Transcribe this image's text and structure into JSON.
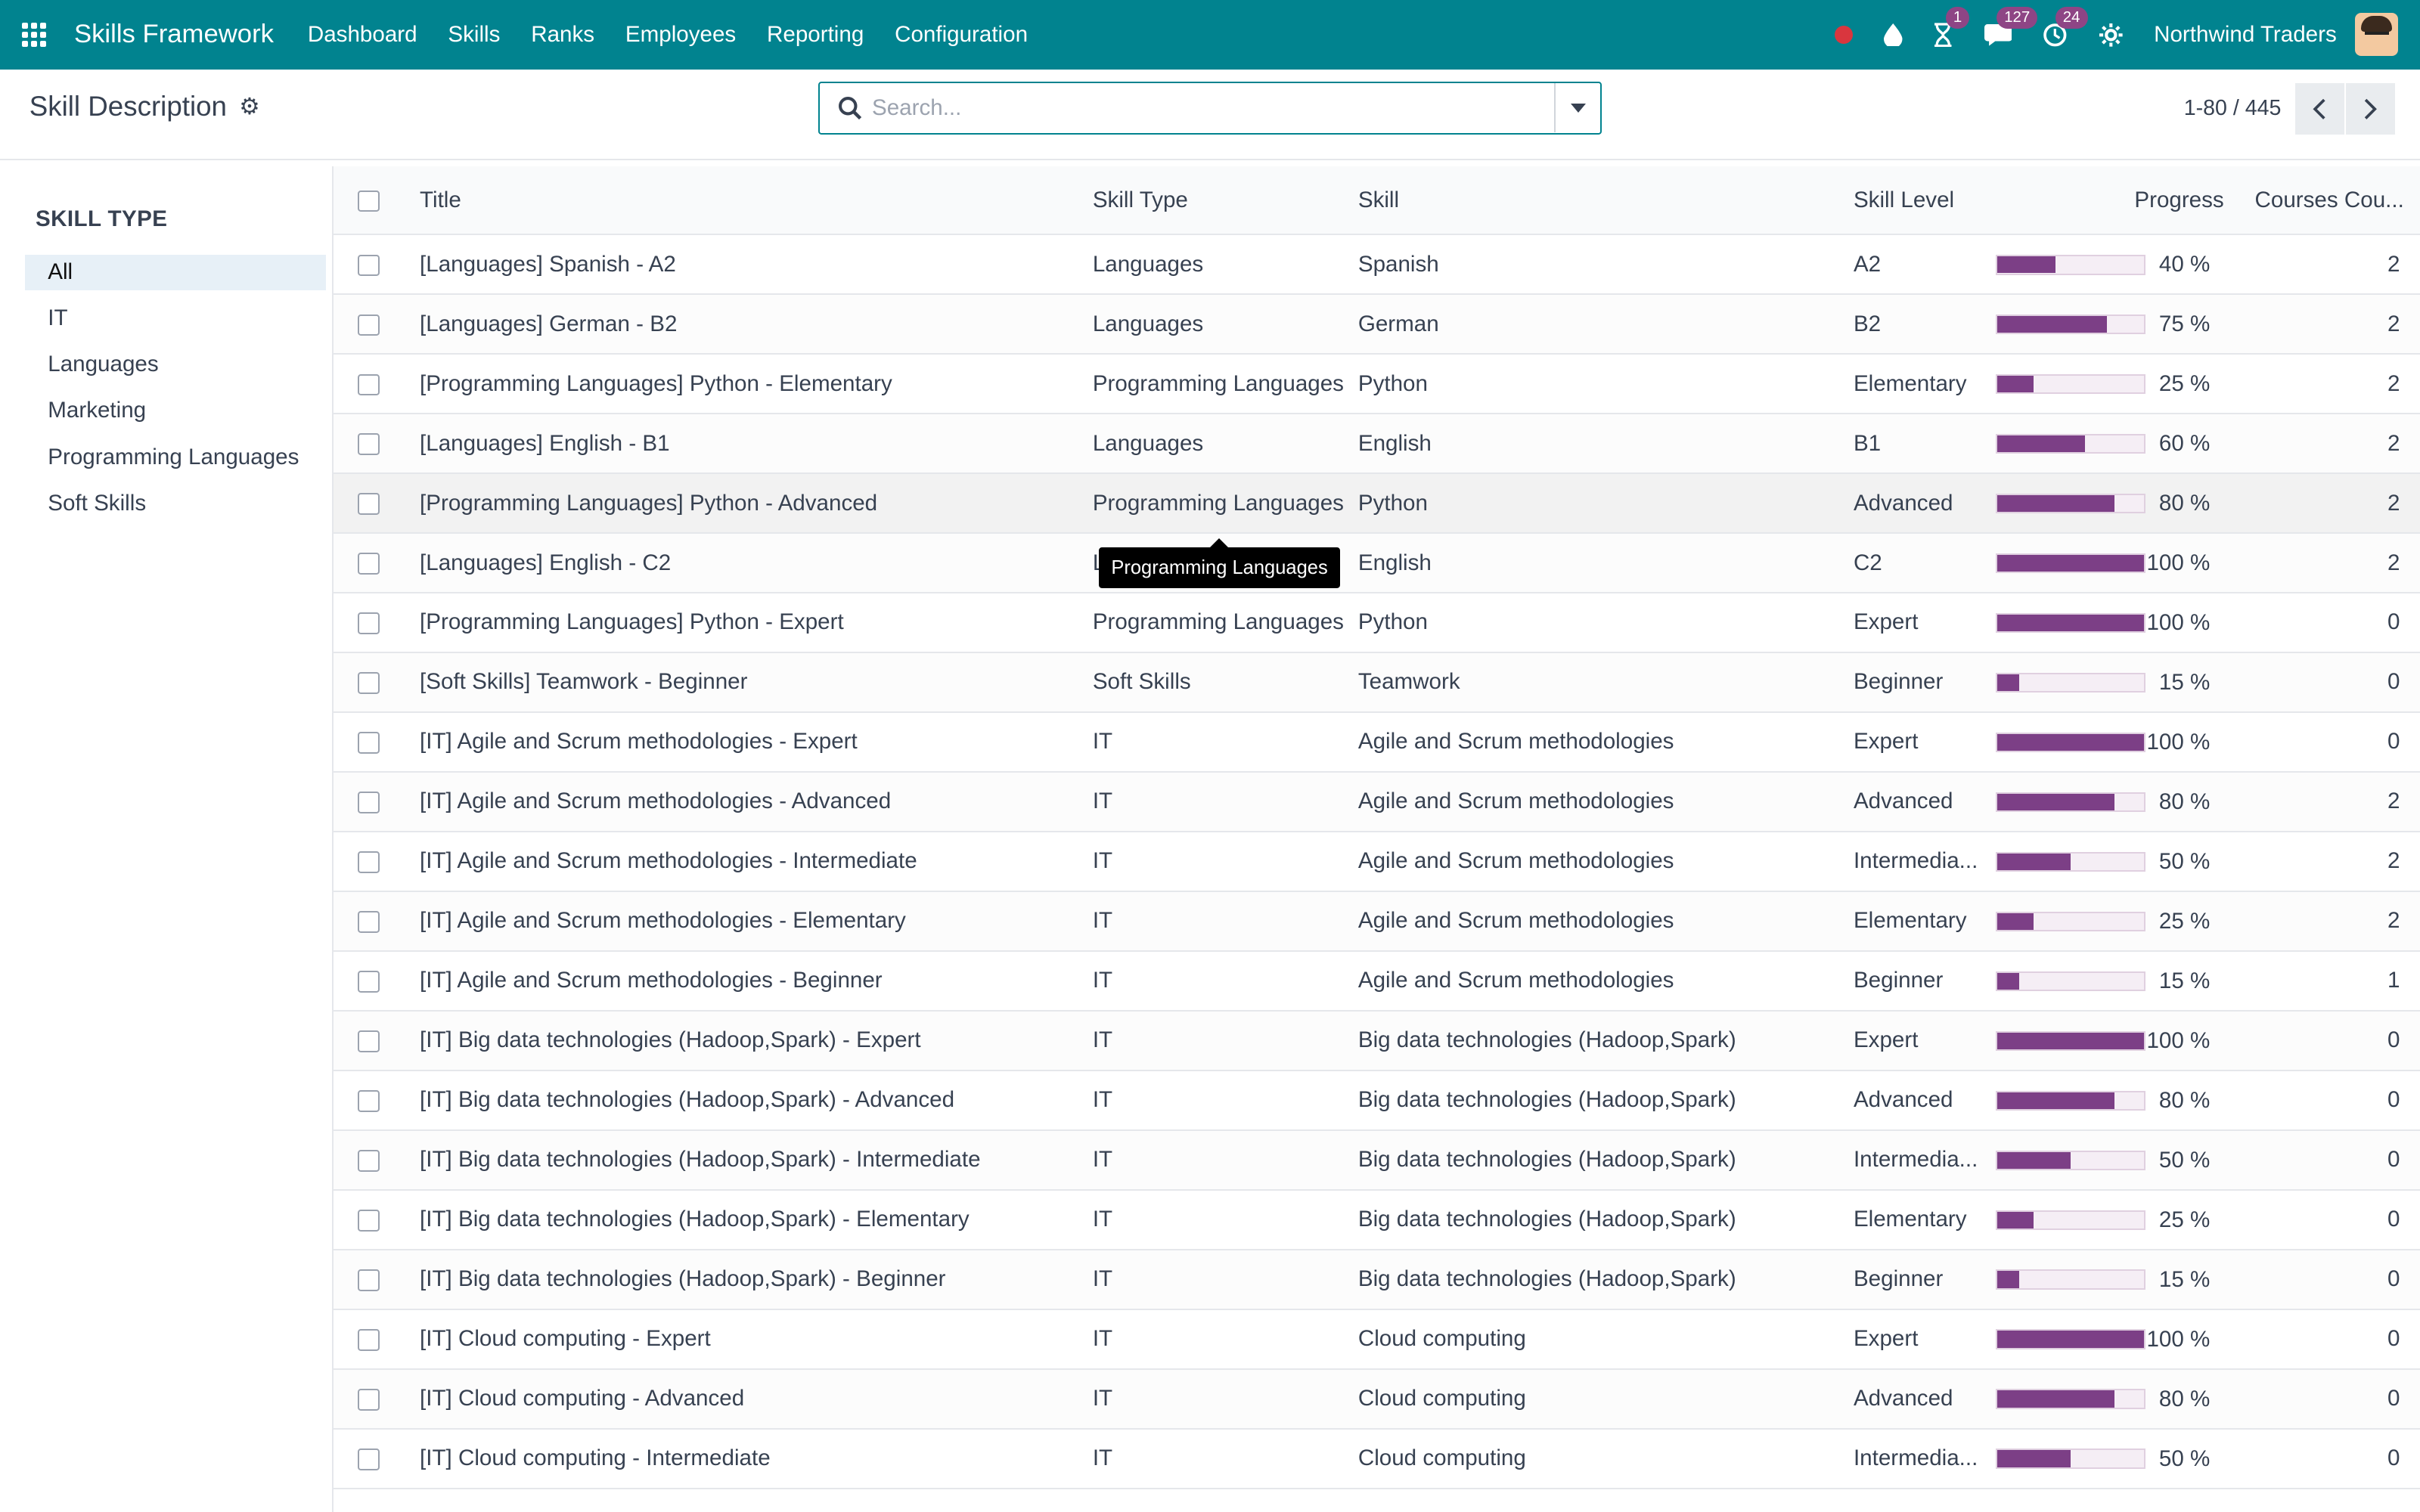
{
  "navbar": {
    "brand": "Skills Framework",
    "menu": [
      "Dashboard",
      "Skills",
      "Ranks",
      "Employees",
      "Reporting",
      "Configuration"
    ],
    "activities_count": "1",
    "messages_count": "127",
    "clock_count": "24",
    "company": "Northwind Traders"
  },
  "control": {
    "title": "Skill Description",
    "search_placeholder": "Search...",
    "pager": "1-80 / 445"
  },
  "sidebar": {
    "heading": "SKILL TYPE",
    "items": [
      "All",
      "IT",
      "Languages",
      "Marketing",
      "Programming Languages",
      "Soft Skills"
    ]
  },
  "table": {
    "columns": [
      "Title",
      "Skill Type",
      "Skill",
      "Skill Level",
      "Progress",
      "Courses Cou..."
    ],
    "rows": [
      {
        "title": "[Languages] Spanish - A2",
        "type": "Languages",
        "skill": "Spanish",
        "level": "A2",
        "progress": 40,
        "progress_label": "40 %",
        "courses": "2"
      },
      {
        "title": "[Languages] German - B2",
        "type": "Languages",
        "skill": "German",
        "level": "B2",
        "progress": 75,
        "progress_label": "75 %",
        "courses": "2"
      },
      {
        "title": "[Programming Languages] Python - Elementary",
        "type": "Programming Languages",
        "skill": "Python",
        "level": "Elementary",
        "progress": 25,
        "progress_label": "25 %",
        "courses": "2"
      },
      {
        "title": "[Languages] English - B1",
        "type": "Languages",
        "skill": "English",
        "level": "B1",
        "progress": 60,
        "progress_label": "60 %",
        "courses": "2"
      },
      {
        "title": "[Programming Languages] Python - Advanced",
        "type": "Programming Languages",
        "skill": "Python",
        "level": "Advanced",
        "progress": 80,
        "progress_label": "80 %",
        "courses": "2"
      },
      {
        "title": "[Languages] English - C2",
        "type": "Languages",
        "skill": "English",
        "level": "C2",
        "progress": 100,
        "progress_label": "100 %",
        "courses": "2"
      },
      {
        "title": "[Programming Languages] Python - Expert",
        "type": "Programming Languages",
        "skill": "Python",
        "level": "Expert",
        "progress": 100,
        "progress_label": "100 %",
        "courses": "0"
      },
      {
        "title": "[Soft Skills] Teamwork - Beginner",
        "type": "Soft Skills",
        "skill": "Teamwork",
        "level": "Beginner",
        "progress": 15,
        "progress_label": "15 %",
        "courses": "0"
      },
      {
        "title": "[IT] Agile and Scrum methodologies - Expert",
        "type": "IT",
        "skill": "Agile and Scrum methodologies",
        "level": "Expert",
        "progress": 100,
        "progress_label": "100 %",
        "courses": "0"
      },
      {
        "title": "[IT] Agile and Scrum methodologies - Advanced",
        "type": "IT",
        "skill": "Agile and Scrum methodologies",
        "level": "Advanced",
        "progress": 80,
        "progress_label": "80 %",
        "courses": "2"
      },
      {
        "title": "[IT] Agile and Scrum methodologies - Intermediate",
        "type": "IT",
        "skill": "Agile and Scrum methodologies",
        "level": "Intermedia...",
        "progress": 50,
        "progress_label": "50 %",
        "courses": "2"
      },
      {
        "title": "[IT] Agile and Scrum methodologies - Elementary",
        "type": "IT",
        "skill": "Agile and Scrum methodologies",
        "level": "Elementary",
        "progress": 25,
        "progress_label": "25 %",
        "courses": "2"
      },
      {
        "title": "[IT] Agile and Scrum methodologies - Beginner",
        "type": "IT",
        "skill": "Agile and Scrum methodologies",
        "level": "Beginner",
        "progress": 15,
        "progress_label": "15 %",
        "courses": "1"
      },
      {
        "title": "[IT] Big data technologies (Hadoop,Spark) - Expert",
        "type": "IT",
        "skill": "Big data technologies (Hadoop,Spark)",
        "level": "Expert",
        "progress": 100,
        "progress_label": "100 %",
        "courses": "0"
      },
      {
        "title": "[IT] Big data technologies (Hadoop,Spark) - Advanced",
        "type": "IT",
        "skill": "Big data technologies (Hadoop,Spark)",
        "level": "Advanced",
        "progress": 80,
        "progress_label": "80 %",
        "courses": "0"
      },
      {
        "title": "[IT] Big data technologies (Hadoop,Spark) - Intermediate",
        "type": "IT",
        "skill": "Big data technologies (Hadoop,Spark)",
        "level": "Intermedia...",
        "progress": 50,
        "progress_label": "50 %",
        "courses": "0"
      },
      {
        "title": "[IT] Big data technologies (Hadoop,Spark) - Elementary",
        "type": "IT",
        "skill": "Big data technologies (Hadoop,Spark)",
        "level": "Elementary",
        "progress": 25,
        "progress_label": "25 %",
        "courses": "0"
      },
      {
        "title": "[IT] Big data technologies (Hadoop,Spark) - Beginner",
        "type": "IT",
        "skill": "Big data technologies (Hadoop,Spark)",
        "level": "Beginner",
        "progress": 15,
        "progress_label": "15 %",
        "courses": "0"
      },
      {
        "title": "[IT] Cloud computing - Expert",
        "type": "IT",
        "skill": "Cloud computing",
        "level": "Expert",
        "progress": 100,
        "progress_label": "100 %",
        "courses": "0"
      },
      {
        "title": "[IT] Cloud computing - Advanced",
        "type": "IT",
        "skill": "Cloud computing",
        "level": "Advanced",
        "progress": 80,
        "progress_label": "80 %",
        "courses": "0"
      },
      {
        "title": "[IT] Cloud computing - Intermediate",
        "type": "IT",
        "skill": "Cloud computing",
        "level": "Intermedia...",
        "progress": 50,
        "progress_label": "50 %",
        "courses": "0"
      }
    ],
    "hover_row_index": 4
  },
  "tooltip": {
    "text": "Programming Languages"
  },
  "colors": {
    "navbar": "#01838f",
    "progress": "#7c3f86",
    "badge": "#8e4585",
    "record": "#d9363e"
  },
  "icons": [
    "apps-grid-icon",
    "record-dot-icon",
    "drop-icon",
    "hourglass-icon",
    "chat-icon",
    "clock-icon",
    "settings-icon",
    "search-icon",
    "chevron-left-icon",
    "chevron-right-icon"
  ]
}
